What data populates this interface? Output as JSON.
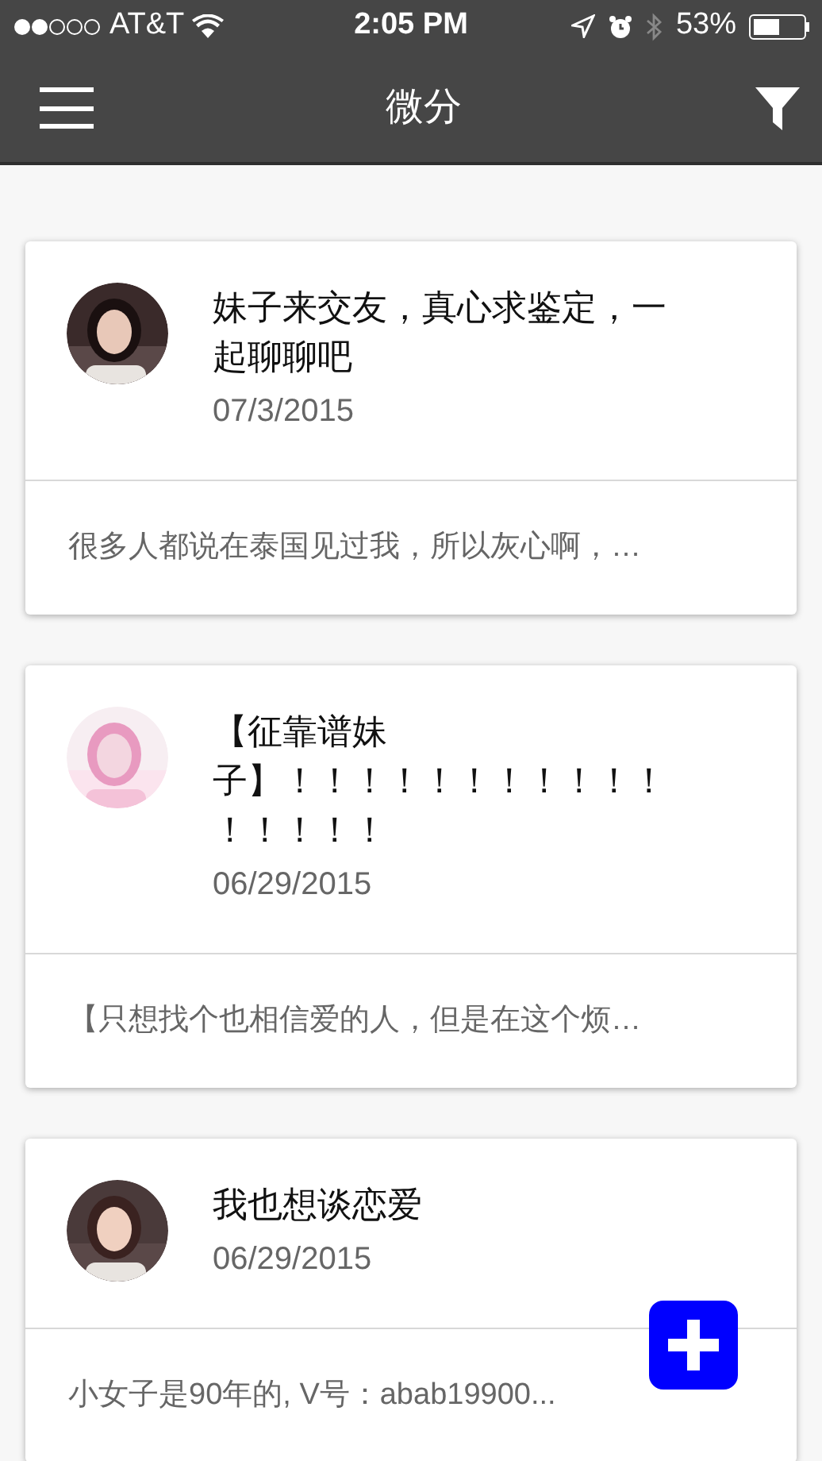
{
  "status_bar": {
    "signal_dots": [
      {
        "on": true
      },
      {
        "on": true
      },
      {
        "on": false
      },
      {
        "on": false
      },
      {
        "on": false
      }
    ],
    "carrier": "AT&T",
    "time": "2:05 PM",
    "battery": "53%"
  },
  "nav_bar": {
    "title": "微分"
  },
  "posts": [
    {
      "title_lines": [
        "妹子来交友，真心求鉴定，一",
        "起聊聊吧"
      ],
      "date": "07/3/2015",
      "excerpt": "很多人都说在泰国见过我，所以灰心啊，…"
    },
    {
      "title_lines": [
        "【征靠谱妹",
        "子】！！！！！！！！！！！",
        "！！！！！"
      ],
      "date": "06/29/2015",
      "excerpt": "【只想找个也相信爱的人，但是在这个烦…"
    },
    {
      "title_lines": [
        "我也想谈恋爱"
      ],
      "date": "06/29/2015",
      "excerpt": "小女子是90年的, V号：abab19900..."
    }
  ]
}
